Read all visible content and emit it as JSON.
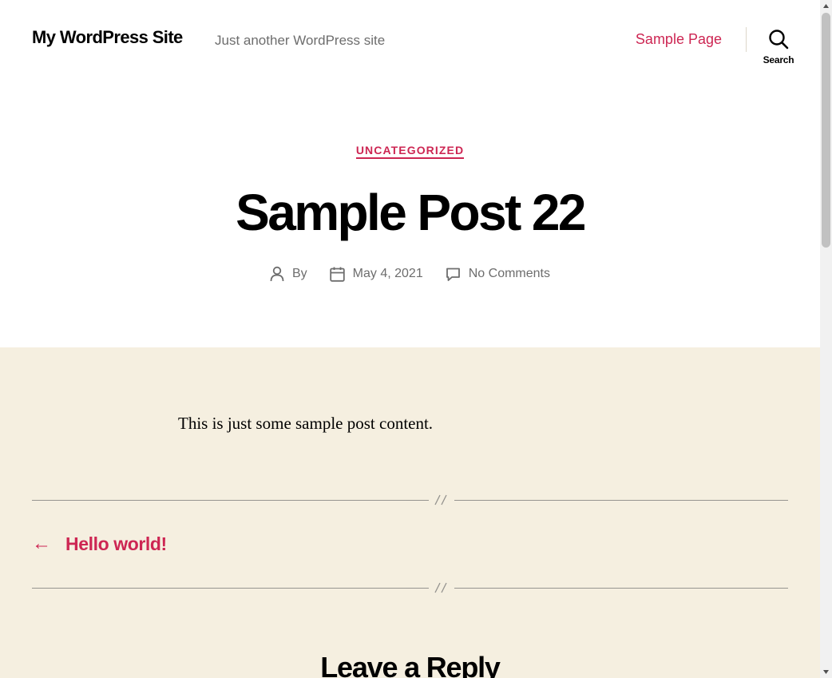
{
  "header": {
    "site_title": "My WordPress Site",
    "tagline": "Just another WordPress site",
    "nav": [
      {
        "label": "Sample Page"
      }
    ],
    "search_label": "Search"
  },
  "post": {
    "category": "UNCATEGORIZED",
    "title": "Sample Post 22",
    "author_prefix": "By",
    "date": "May 4, 2021",
    "comments": "No Comments",
    "content": "This is just some sample post content."
  },
  "navigation": {
    "prev_arrow": "←",
    "prev_title": "Hello world!"
  },
  "comments_section": {
    "reply_title": "Leave a Reply"
  },
  "colors": {
    "accent": "#cd2653",
    "band": "#f5efe0",
    "meta_text": "#6d6d6d"
  }
}
